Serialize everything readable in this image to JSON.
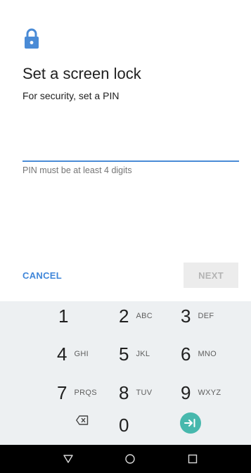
{
  "header": {
    "icon": "lock-icon",
    "title": "Set a screen lock",
    "subtitle": "For security, set a PIN"
  },
  "pin_field": {
    "value": "",
    "hint": "PIN must be at least 4 digits"
  },
  "actions": {
    "cancel_label": "CANCEL",
    "next_label": "NEXT"
  },
  "keypad": {
    "keys": [
      {
        "num": "1",
        "letters": ""
      },
      {
        "num": "2",
        "letters": "ABC"
      },
      {
        "num": "3",
        "letters": "DEF"
      },
      {
        "num": "4",
        "letters": "GHI"
      },
      {
        "num": "5",
        "letters": "JKL"
      },
      {
        "num": "6",
        "letters": "MNO"
      },
      {
        "num": "7",
        "letters": "PRQS"
      },
      {
        "num": "8",
        "letters": "TUV"
      },
      {
        "num": "9",
        "letters": "WXYZ"
      },
      {
        "num": "0",
        "letters": ""
      }
    ],
    "delete_icon": "backspace-icon",
    "enter_icon": "enter-icon"
  },
  "navigation_bar": {
    "back_icon": "back-triangle-icon",
    "home_icon": "home-circle-icon",
    "recents_icon": "recents-square-icon"
  },
  "colors": {
    "accent": "#4a8bd6",
    "cancel": "#3f86d9",
    "enter_key": "#47b8ad",
    "keypad_bg": "#edf0f2",
    "next_disabled_bg": "#ececec",
    "nav_bar": "#000000"
  }
}
